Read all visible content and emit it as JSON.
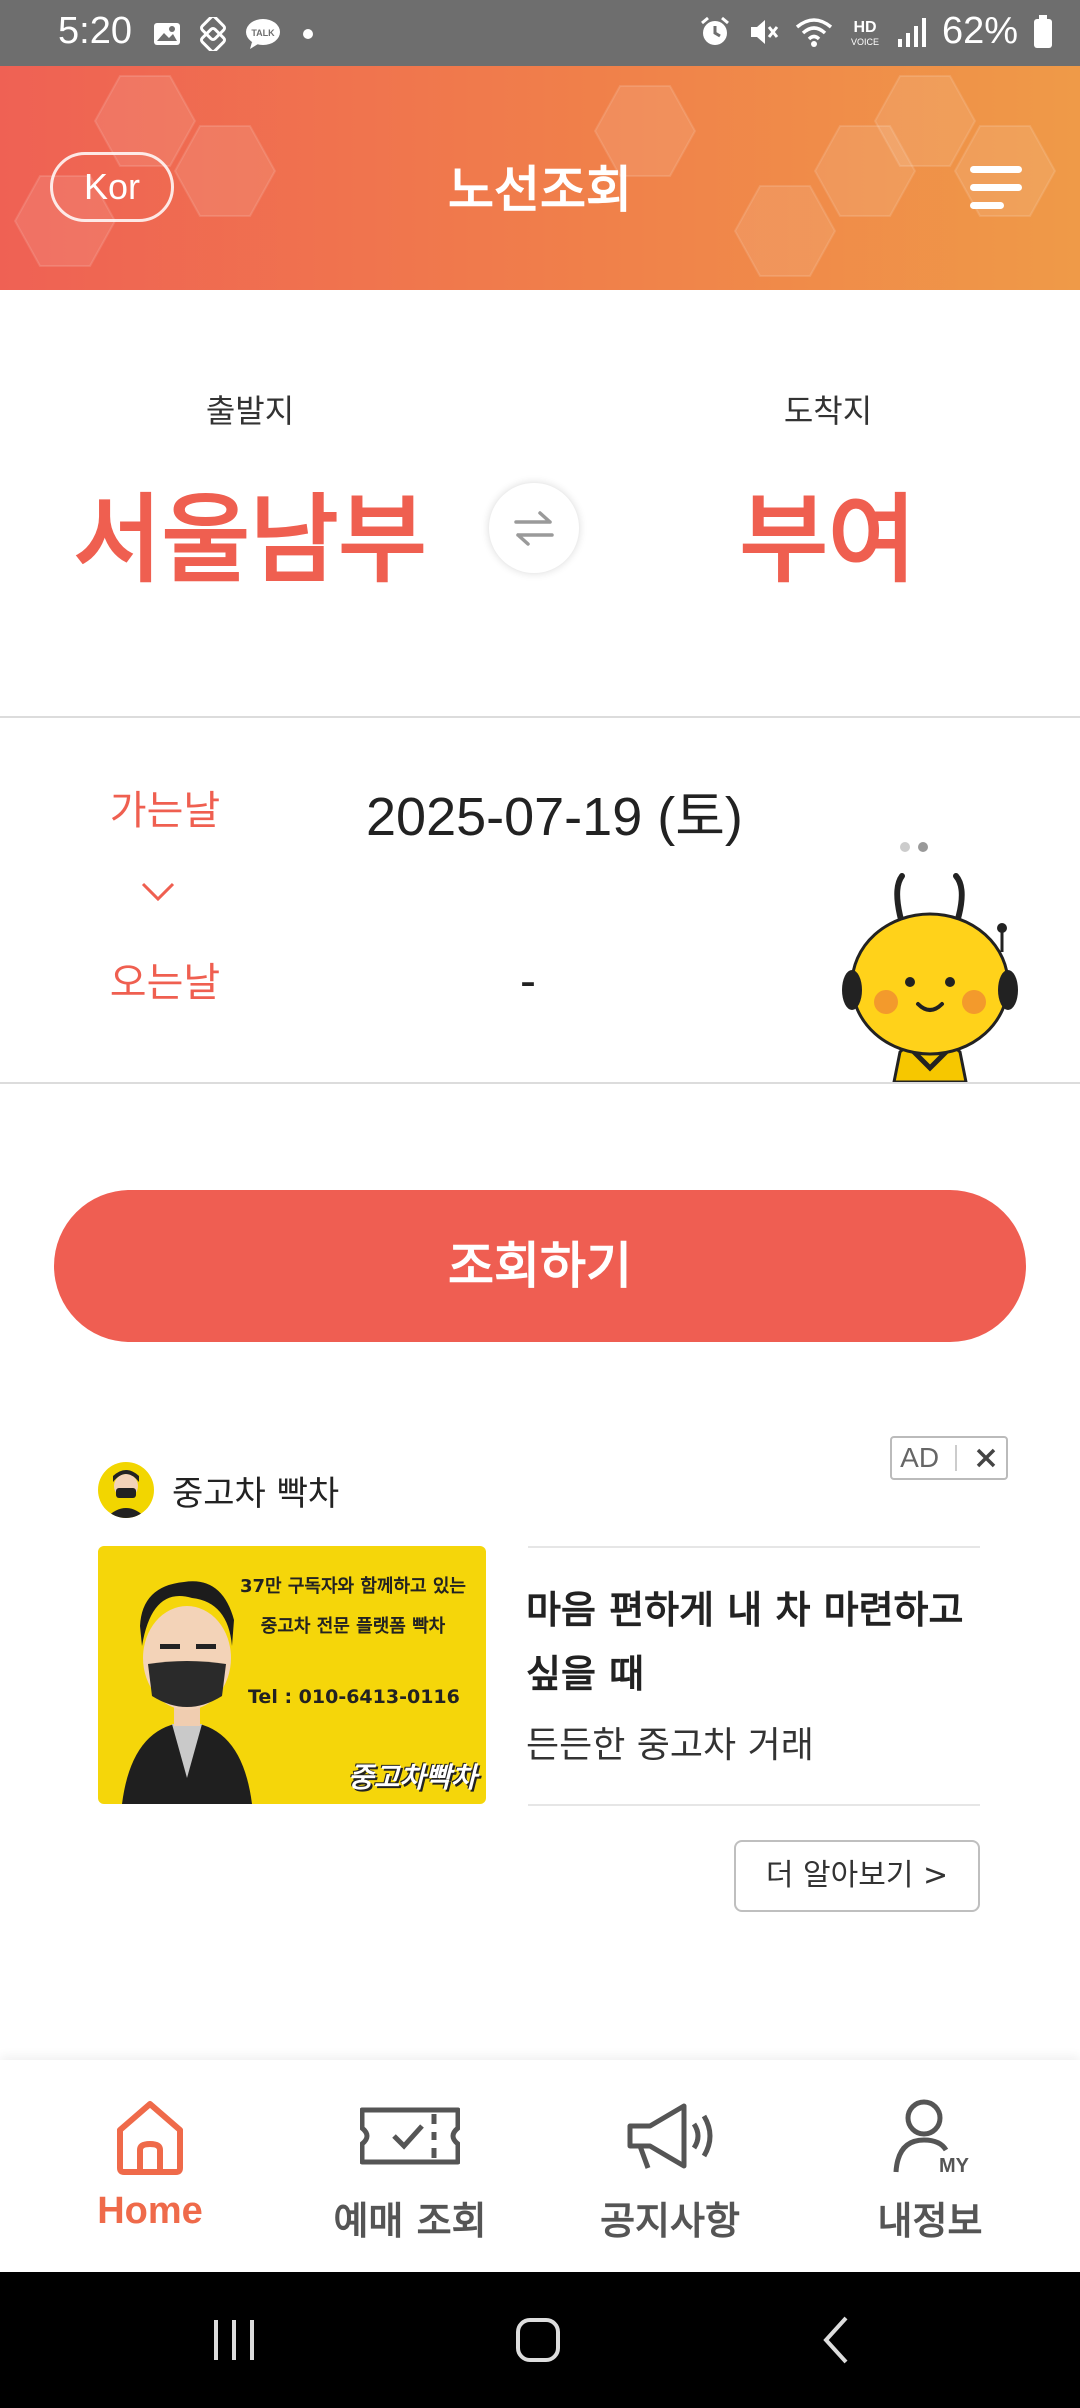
{
  "status_bar": {
    "time": "5:20",
    "battery": "62%",
    "left_icons": [
      "gallery-icon",
      "link-icon",
      "talk-icon",
      "dot-icon"
    ],
    "right_icons": [
      "alarm-icon",
      "mute-icon",
      "wifi-icon",
      "hd-voice-icon",
      "signal-icon",
      "battery-icon"
    ]
  },
  "header": {
    "title": "노선조회",
    "language_button": "Kor",
    "menu_icon": "hamburger-menu-icon",
    "colors": {
      "gradient_start": "#ef6154",
      "gradient_end": "#ef9a48"
    }
  },
  "route": {
    "departure_label": "출발지",
    "departure": "서울남부",
    "arrival_label": "도착지",
    "arrival": "부여",
    "swap_icon": "swap-arrows-icon",
    "accent_color": "#ef5f50"
  },
  "dates": {
    "go_label": "가는날",
    "go_date": "2025-07-19 (토)",
    "return_label": "오는날",
    "return_date": "-",
    "pager": {
      "count": 2,
      "active": 2
    }
  },
  "search_button": {
    "label": "조회하기",
    "color": "#ef5e52"
  },
  "ad": {
    "tag": "AD",
    "brand": "중고차 빡차",
    "image_text": {
      "line1": "37만 구독자와 함께하고 있는",
      "line2": "중고차 전문 플랫폼 빡차",
      "tel": "Tel : 010-6413-0116",
      "logo": "중고차빡차"
    },
    "headline": "마음 편하게 내 차 마련하고 싶을 때",
    "subtitle": "든든한 중고차 거래",
    "cta": "더 알아보기 >"
  },
  "bottom_nav": {
    "items": [
      {
        "label": "Home",
        "icon": "home-icon",
        "active": true
      },
      {
        "label": "예매 조회",
        "icon": "ticket-check-icon",
        "active": false
      },
      {
        "label": "공지사항",
        "icon": "megaphone-icon",
        "active": false
      },
      {
        "label": "내정보",
        "icon": "my-profile-icon",
        "active": false
      }
    ],
    "active_color": "#ef6a4a"
  }
}
